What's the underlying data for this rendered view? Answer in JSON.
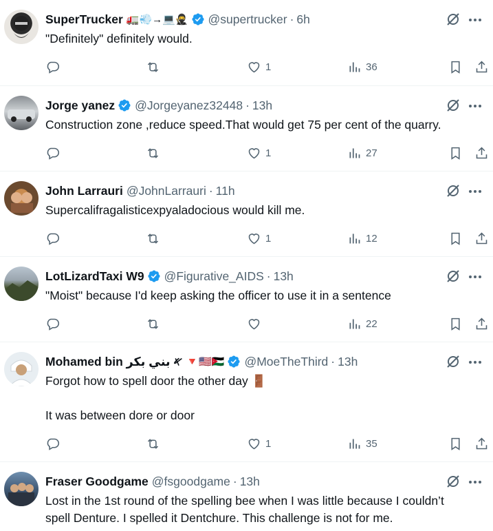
{
  "tweets": [
    {
      "name": "SuperTrucker",
      "name_emoji": "🚛💨→💻🥷",
      "verified": true,
      "handle": "@supertrucker",
      "time": "6h",
      "lines": [
        "\"Definitely\" definitely would."
      ],
      "likes": "1",
      "views": "36"
    },
    {
      "name": "Jorge yanez",
      "name_emoji": "",
      "verified": true,
      "handle": "@Jorgeyanez32448",
      "time": "13h",
      "lines": [
        "Construction zone ,reduce speed.That would get 75 per cent of the quarry."
      ],
      "likes": "1",
      "views": "27"
    },
    {
      "name": "John Larrauri",
      "name_emoji": "",
      "verified": false,
      "handle": "@JohnLarrauri",
      "time": "11h",
      "lines": [
        "Supercalifragalisticexpyaladocious would kill me."
      ],
      "likes": "1",
      "views": "12"
    },
    {
      "name": "LotLizardTaxi W9",
      "name_emoji": "",
      "verified": true,
      "handle": "@Figurative_AIDS",
      "time": "13h",
      "lines": [
        "\"Moist\" because I'd keep asking the officer to use it in a sentence"
      ],
      "likes": "",
      "views": "22"
    },
    {
      "name": "Mohamed bin 𐤀 بني بكر",
      "name_emoji": "🔻🇺🇸🇯🇴",
      "verified": true,
      "handle": "@MoeTheThird",
      "time": "13h",
      "lines": [
        "Forgot how to spell door the other day 🚪",
        "",
        "It was between dore or door"
      ],
      "likes": "1",
      "views": "35"
    },
    {
      "name": "Fraser Goodgame",
      "name_emoji": "",
      "verified": false,
      "handle": "@fsgoodgame",
      "time": "13h",
      "lines": [
        "Lost in the 1st round of the spelling bee when I was little because I couldn’t",
        "spell Denture. I spelled it Dentchure. This challenge is not for me."
      ],
      "likes": "",
      "views": ""
    }
  ],
  "colors": {
    "text": "#0f1419",
    "secondary": "#536471",
    "verified": "#1d9bf0",
    "divider": "#eff3f4"
  }
}
